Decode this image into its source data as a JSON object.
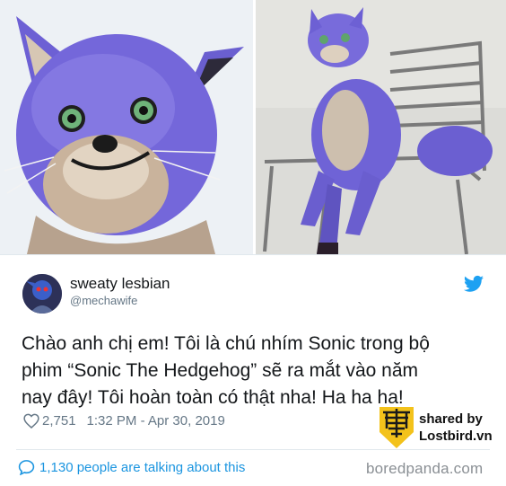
{
  "user": {
    "display_name": "sweaty lesbian",
    "handle": "@mechawife"
  },
  "tweet": {
    "lines": [
      "Chào anh chị em! Tôi là chú nhím Sonic trong bộ",
      "phim “Sonic The Hedgehog” sẽ ra mắt vào năm",
      "nay đây! Tôi hoàn toàn có thật nha! Ha ha ha!"
    ],
    "likes": "2,751",
    "timestamp": "1:32 PM - Apr 30, 2019"
  },
  "conversation": {
    "label": "1,130 people are talking about this"
  },
  "watermark": {
    "line1": "shared by",
    "line2": "Lostbird.vn"
  },
  "source": "boredpanda.com",
  "colors": {
    "twitter_blue": "#1da1f2",
    "link_blue": "#1b95e0",
    "grey_text": "#657786",
    "fur_purple": "#6e62d6"
  },
  "icons": {
    "bird": "twitter-bird-icon",
    "heart": "heart-icon",
    "bubble": "speech-bubble-icon"
  }
}
